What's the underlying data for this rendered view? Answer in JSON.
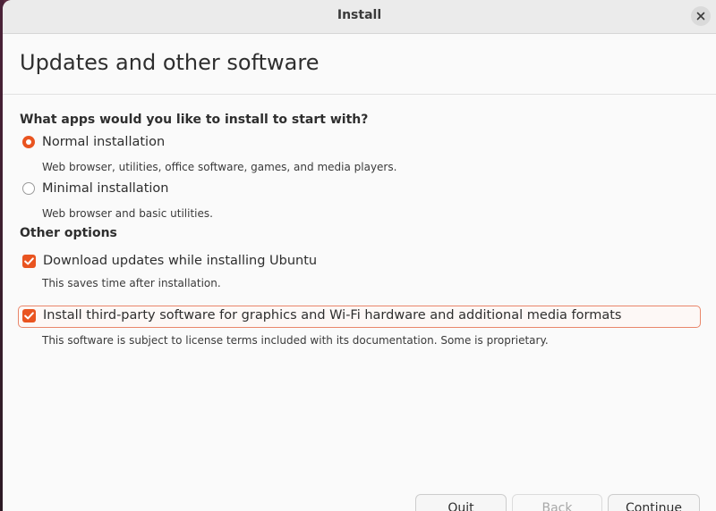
{
  "window": {
    "title": "Install"
  },
  "page": {
    "heading": "Updates and other software"
  },
  "apps_section": {
    "heading": "What apps would you like to install to start with?",
    "options": [
      {
        "label": "Normal installation",
        "description": "Web browser, utilities, office software, games, and media players.",
        "selected": true
      },
      {
        "label": "Minimal installation",
        "description": "Web browser and basic utilities.",
        "selected": false
      }
    ]
  },
  "other_section": {
    "heading": "Other options",
    "options": [
      {
        "label": "Download updates while installing Ubuntu",
        "description": "This saves time after installation.",
        "checked": true
      },
      {
        "label": "Install third-party software for graphics and Wi-Fi hardware and additional media formats",
        "description": "This software is subject to license terms included with its documentation. Some is proprietary.",
        "checked": true
      }
    ]
  },
  "buttons": {
    "quit": "Quit",
    "back": "Back",
    "continue": "Continue"
  },
  "colors": {
    "accent": "#e95420",
    "focus_border": "#e9866a",
    "desktop_bg": "#5a2a3f"
  },
  "icons": {
    "close": "close-icon",
    "check": "checkmark-icon"
  }
}
